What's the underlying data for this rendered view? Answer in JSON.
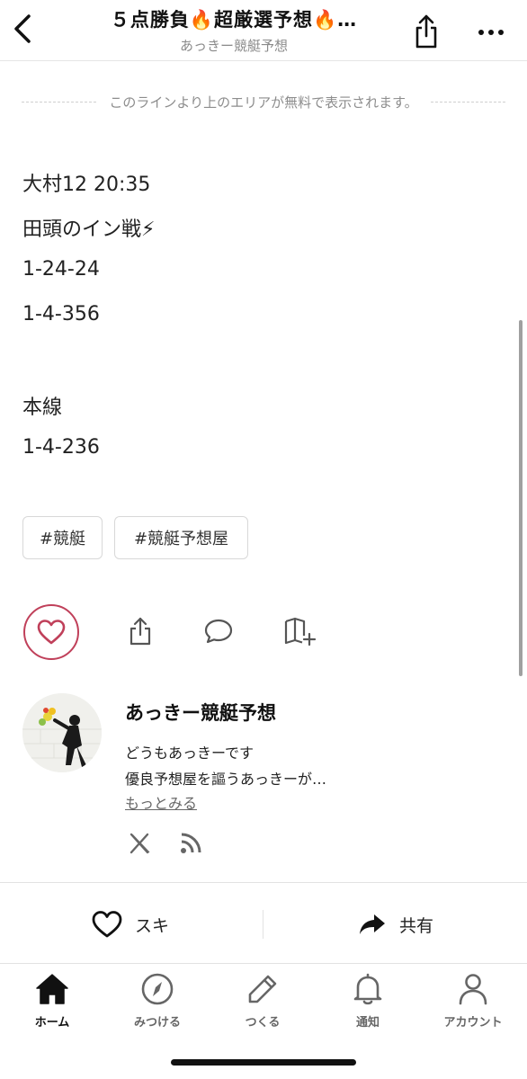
{
  "header": {
    "title": "５点勝負🔥超厳選予想🔥…",
    "subtitle": "あっきー競艇予想"
  },
  "free_line_text": "このラインより上のエリアが無料で表示されます。",
  "content": {
    "lines": [
      "大村12 20:35",
      "田頭のイン戦⚡",
      "1-24-24",
      "1-4-356",
      "本線",
      "1-4-236"
    ]
  },
  "tags": [
    "#競艇",
    "#競艇予想屋"
  ],
  "creator": {
    "name": "あっきー競艇予想",
    "bio_lines": [
      "どうもあっきーです",
      "優良予想屋を謳うあっきーが…"
    ],
    "more_label": "もっとみる"
  },
  "actions_bar": {
    "like_label": "スキ",
    "share_label": "共有"
  },
  "tabs": [
    {
      "label": "ホーム",
      "icon": "home-icon",
      "active": true
    },
    {
      "label": "みつける",
      "icon": "compass-icon",
      "active": false
    },
    {
      "label": "つくる",
      "icon": "pencil-icon",
      "active": false
    },
    {
      "label": "通知",
      "icon": "bell-icon",
      "active": false
    },
    {
      "label": "アカウント",
      "icon": "person-icon",
      "active": false
    }
  ],
  "colors": {
    "like_accent": "#c0405a",
    "text": "#222222",
    "muted": "#8a8a8a"
  }
}
